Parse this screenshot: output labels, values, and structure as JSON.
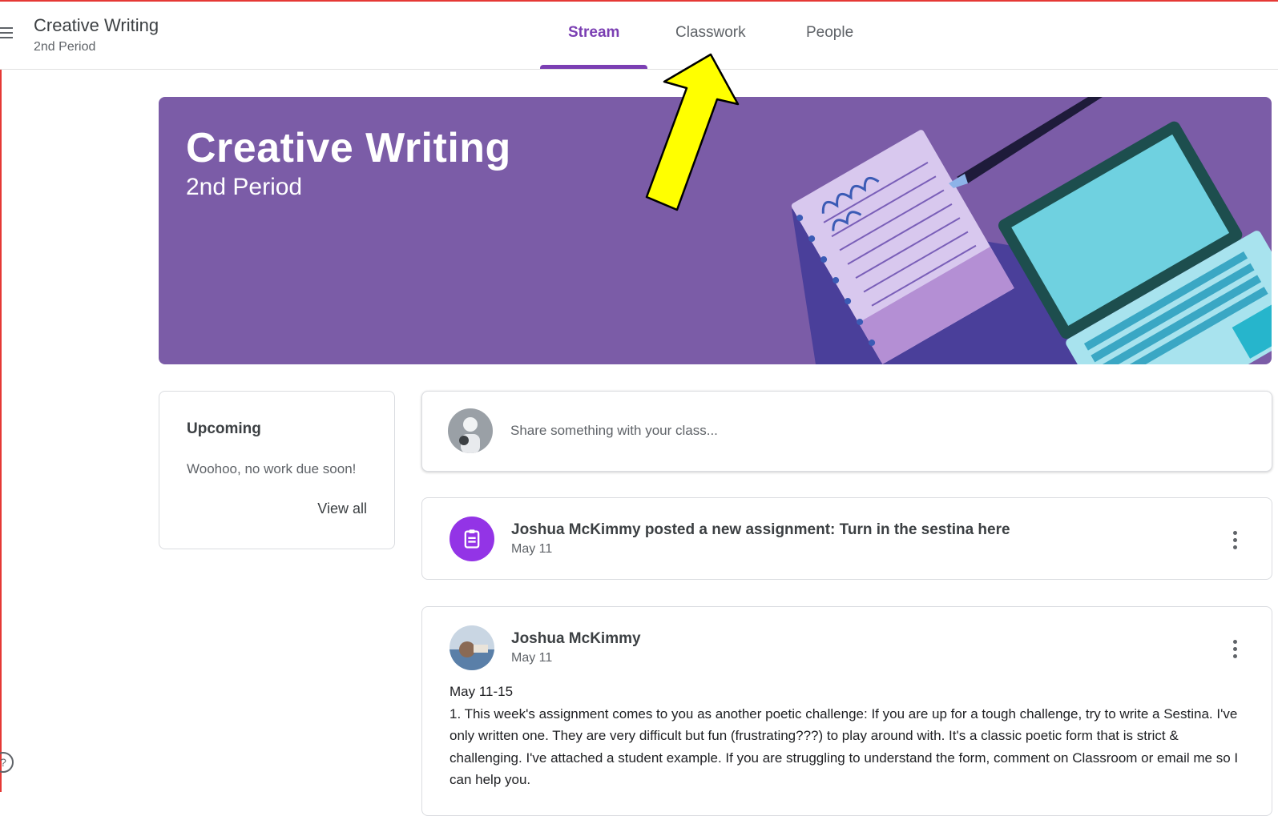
{
  "header": {
    "class_name": "Creative Writing",
    "class_section": "2nd Period",
    "tabs": [
      {
        "label": "Stream",
        "active": true
      },
      {
        "label": "Classwork",
        "active": false
      },
      {
        "label": "People",
        "active": false
      }
    ]
  },
  "banner": {
    "title": "Creative Writing",
    "subtitle": "2nd Period",
    "color": "#7b5ca7"
  },
  "upcoming": {
    "title": "Upcoming",
    "message": "Woohoo, no work due soon!",
    "view_all_label": "View all"
  },
  "share": {
    "placeholder": "Share something with your class..."
  },
  "posts": [
    {
      "type": "assignment",
      "title": "Joshua McKimmy posted a new assignment: Turn in the sestina here",
      "date": "May 11",
      "icon": "assignment-icon"
    },
    {
      "type": "announcement",
      "author": "Joshua McKimmy",
      "date": "May 11",
      "heading": "May 11-15",
      "body": "1. This week's assignment comes to you as another poetic challenge: If you are up for a tough challenge, try to write a Sestina. I've only written one. They are very difficult but fun (frustrating???) to play around with. It's a classic poetic form that is strict & challenging. I've attached a student example. If you are struggling to understand the form, comment on Classroom or email me so I can help you."
    }
  ],
  "colors": {
    "accent": "#7b3fb3",
    "assignment_icon_bg": "#9334e6",
    "annotation_arrow": "#ffff00"
  }
}
